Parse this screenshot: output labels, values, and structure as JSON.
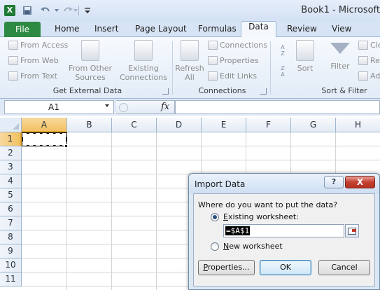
{
  "title_bar": {
    "app_badge": "X",
    "window_title": "Book1 - Microsoft"
  },
  "ribbon_tabs": {
    "file": "File",
    "tabs": [
      "Home",
      "Insert",
      "Page Layout",
      "Formulas",
      "Data",
      "Review",
      "View"
    ],
    "active": "Data"
  },
  "ribbon": {
    "get_external_data": {
      "from_access": "From Access",
      "from_web": "From Web",
      "from_text": "From Text",
      "from_other_line1": "From Other",
      "from_other_line2": "Sources",
      "existing_line1": "Existing",
      "existing_line2": "Connections",
      "label": "Get External Data"
    },
    "connections": {
      "refresh_line1": "Refresh",
      "refresh_line2": "All",
      "connections": "Connections",
      "properties": "Properties",
      "edit_links": "Edit Links",
      "label": "Connections"
    },
    "sort_filter": {
      "sort": "Sort",
      "filter": "Filter",
      "clear_partial": "Cle",
      "reapply_partial": "Re",
      "advanced_partial": "Ad",
      "label": "Sort & Filter"
    }
  },
  "formula_bar": {
    "name_box": "A1",
    "fx": "fx",
    "formula": ""
  },
  "grid": {
    "columns": [
      "A",
      "B",
      "C",
      "D",
      "E",
      "F",
      "G",
      "H"
    ],
    "rows": [
      "1",
      "2",
      "3",
      "4",
      "5",
      "6",
      "7",
      "8",
      "9",
      "10",
      "11"
    ],
    "selected_cell": "A1"
  },
  "dialog": {
    "title": "Import Data",
    "help": "?",
    "close": "X",
    "question": "Where do you want to put the data?",
    "existing_worksheet_first": "E",
    "existing_worksheet_rest": "xisting worksheet:",
    "reference_value": "=$A$1",
    "new_worksheet_first": "N",
    "new_worksheet_rest": "ew worksheet",
    "properties_first": "P",
    "properties_rest": "roperties...",
    "ok": "OK",
    "cancel": "Cancel",
    "selected_option": "existing"
  },
  "colors": {
    "file_tab": "#2d8a43",
    "selection_header": "#f1c15f",
    "dialog_frame": "#dbe7f5",
    "close_button": "#c5412f"
  }
}
